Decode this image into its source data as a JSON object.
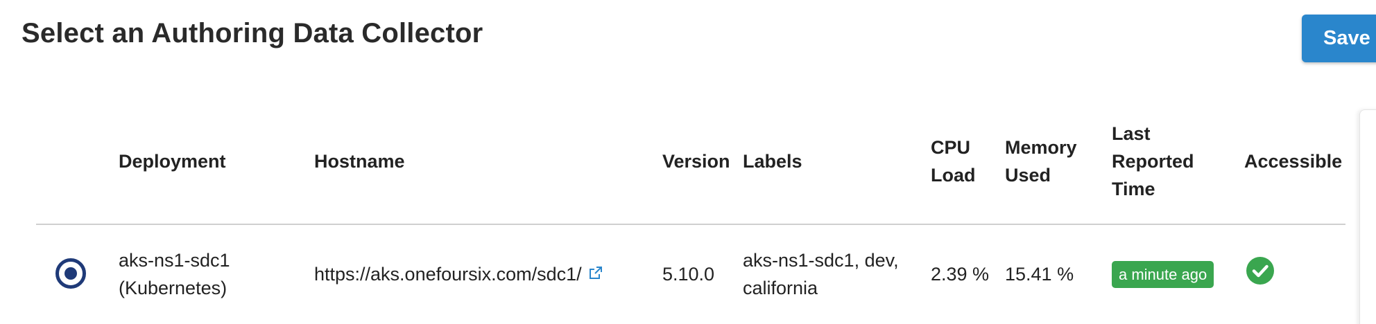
{
  "page": {
    "title": "Select an Authoring Data Collector",
    "save_label": "Save"
  },
  "table": {
    "headers": {
      "deployment": "Deployment",
      "hostname": "Hostname",
      "version": "Version",
      "labels": "Labels",
      "cpu_load_line1": "CPU",
      "cpu_load_line2": "Load",
      "memory_used_line1": "Memory",
      "memory_used_line2": "Used",
      "last_reported_line1": "Last",
      "last_reported_line2": "Reported",
      "last_reported_line3": "Time",
      "accessible": "Accessible"
    },
    "rows": [
      {
        "selected": true,
        "deployment_line1": "aks-ns1-sdc1",
        "deployment_line2": "(Kubernetes)",
        "hostname": "https://aks.onefoursix.com/sdc1/",
        "hostname_link_icon": "external-link-icon",
        "version": "5.10.0",
        "labels_line1": "aks-ns1-sdc1, dev,",
        "labels_line2": "california",
        "cpu_load": "2.39 %",
        "memory_used": "15.41 %",
        "last_reported": "a minute ago",
        "accessible_icon": "check-circle-icon"
      }
    ]
  },
  "colors": {
    "primary_button": "#2a86cc",
    "radio_selected": "#1f3a78",
    "success": "#3aa64f",
    "link": "#2a86cc",
    "divider": "#cfcfcf"
  }
}
